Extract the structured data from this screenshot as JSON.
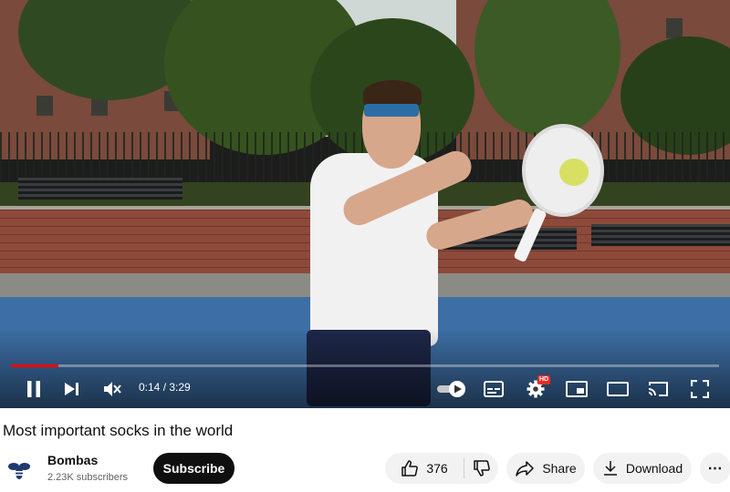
{
  "video": {
    "time_display": "0:14 / 3:29",
    "progress_fraction": 0.067,
    "badge_hd": "HD",
    "accent_color": "#ff0000"
  },
  "controls": {
    "icons": [
      "pause-icon",
      "next-icon",
      "mute-icon",
      "autoplay-toggle-icon",
      "subtitles-icon",
      "settings-icon",
      "miniplayer-icon",
      "theater-mode-icon",
      "cast-icon",
      "fullscreen-icon"
    ]
  },
  "title": "Most important socks in the world",
  "channel": {
    "name": "Bombas",
    "subscribers": "2.23K subscribers",
    "avatar_icon": "bee-icon"
  },
  "actions": {
    "subscribe_label": "Subscribe",
    "like_count": "376",
    "share_label": "Share",
    "download_label": "Download",
    "more_label": "⋯"
  }
}
